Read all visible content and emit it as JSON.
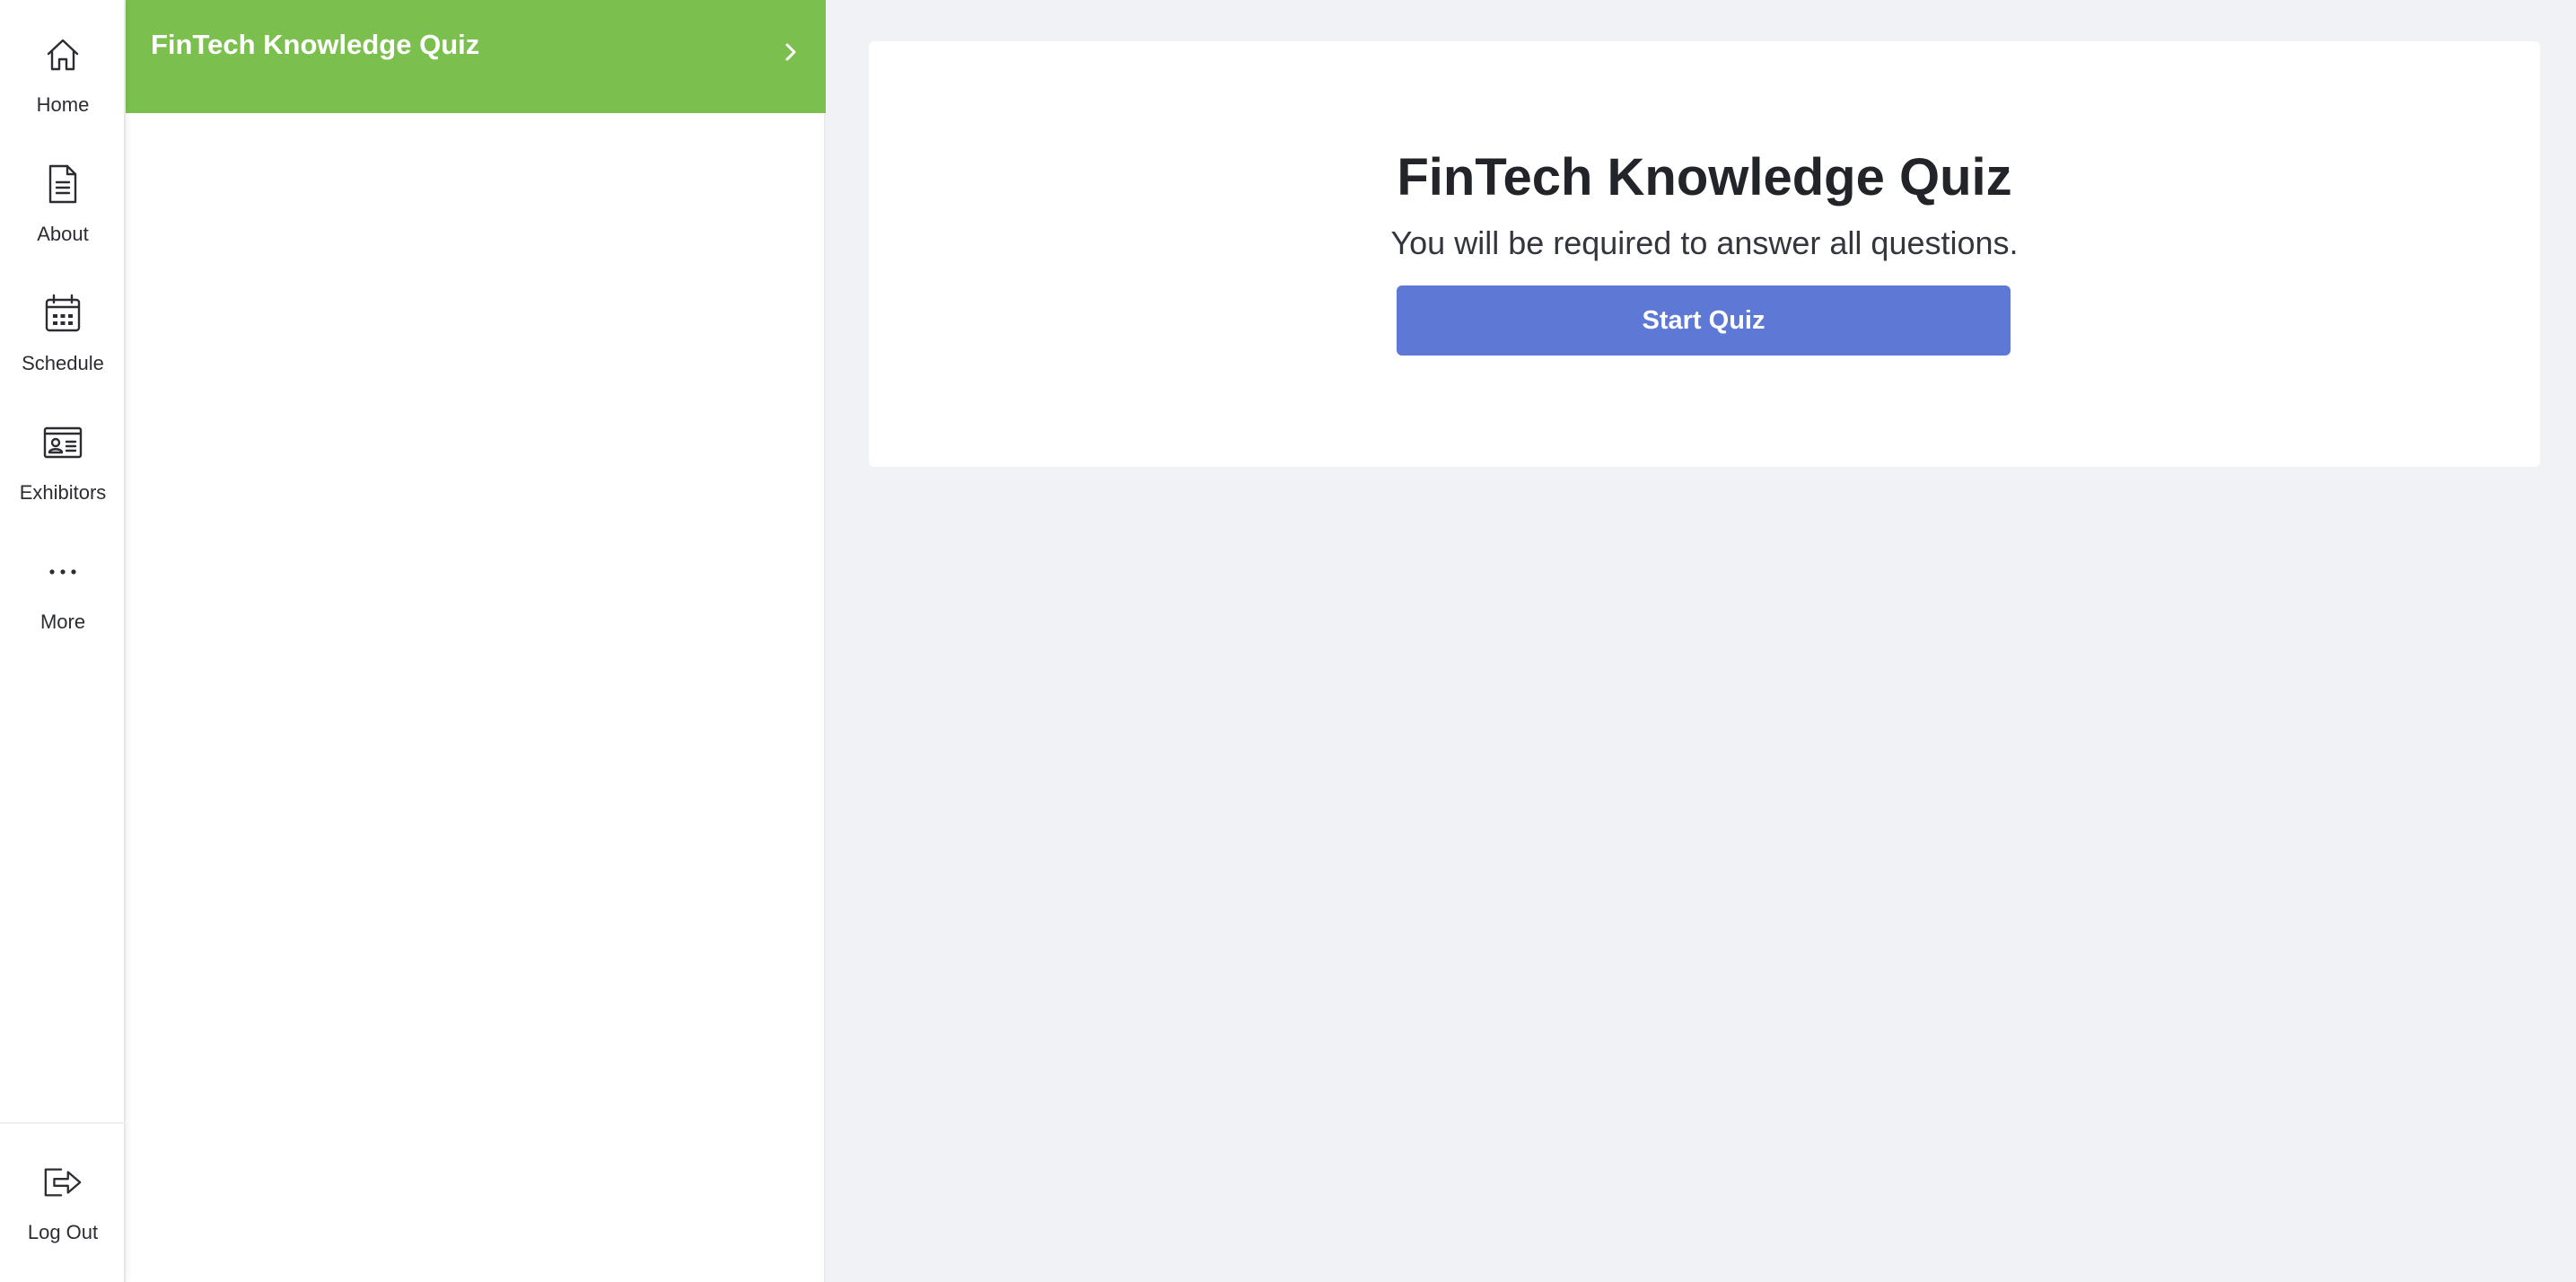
{
  "nav": {
    "items": [
      {
        "label": "Home",
        "icon": "home-icon"
      },
      {
        "label": "About",
        "icon": "document-icon"
      },
      {
        "label": "Schedule",
        "icon": "calendar-icon"
      },
      {
        "label": "Exhibitors",
        "icon": "id-card-icon"
      },
      {
        "label": "More",
        "icon": "more-dots-icon"
      }
    ],
    "logout": {
      "label": "Log Out",
      "icon": "logout-icon"
    }
  },
  "panel": {
    "items": [
      {
        "title": "FinTech Knowledge Quiz",
        "selected": true,
        "icon": "chevron-right-icon"
      }
    ]
  },
  "quiz": {
    "title": "FinTech Knowledge Quiz",
    "subtitle": "You will be required to answer all questions.",
    "start_label": "Start Quiz"
  },
  "colors": {
    "accent_green": "#7bc04f",
    "button_blue": "#5e78d6",
    "background": "#f1f2f6"
  }
}
